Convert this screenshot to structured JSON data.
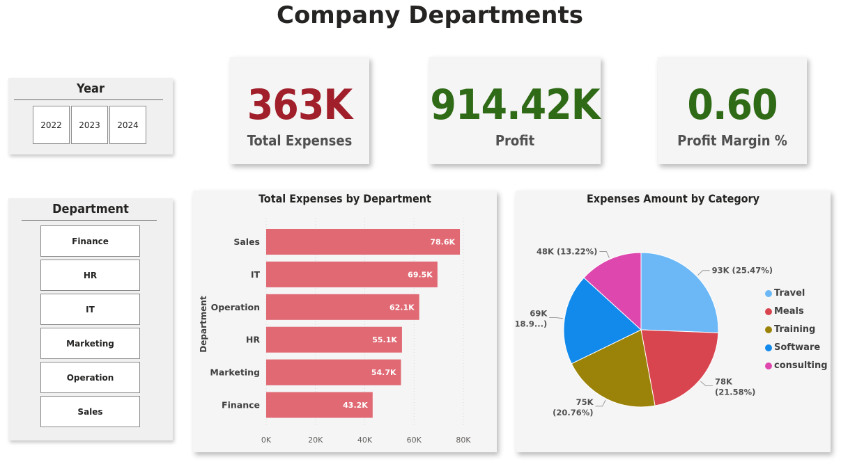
{
  "page": {
    "title": "Company Departments"
  },
  "colors": {
    "expenses": "#a01f2a",
    "profit": "#2f6a16",
    "bar": "#e06973",
    "panel": "#f0f0f0"
  },
  "year_slicer": {
    "title": "Year",
    "items": [
      "2022",
      "2023",
      "2024"
    ]
  },
  "department_slicer": {
    "title": "Department",
    "items": [
      "Finance",
      "HR",
      "IT",
      "Marketing",
      "Operation",
      "Sales"
    ]
  },
  "kpis": {
    "expenses": {
      "value": "363K",
      "label": "Total Expenses"
    },
    "profit": {
      "value": "914.42K",
      "label": "Profit"
    },
    "margin": {
      "value": "0.60",
      "label": "Profit Margin %"
    }
  },
  "chart_data": [
    {
      "type": "bar",
      "orientation": "horizontal",
      "title": "Total Expenses by Department",
      "ylabel": "Department",
      "xlabel": "",
      "categories": [
        "Sales",
        "IT",
        "Operation",
        "HR",
        "Marketing",
        "Finance"
      ],
      "values": [
        78600,
        69500,
        62100,
        55100,
        54700,
        43200
      ],
      "data_labels": [
        "78.6K",
        "69.5K",
        "62.1K",
        "55.1K",
        "54.7K",
        "43.2K"
      ],
      "xlim": [
        0,
        80000
      ],
      "x_ticks": [
        "0K",
        "20K",
        "40K",
        "60K",
        "80K"
      ],
      "grid": true
    },
    {
      "type": "pie",
      "title": "Expenses Amount by Category",
      "labels": [
        "Travel",
        "Meals",
        "Training",
        "Software",
        "consulting"
      ],
      "values": [
        93,
        78,
        75,
        69,
        48
      ],
      "data_labels": [
        "93K (25.47%)",
        "78K (21.58%)",
        "75K (20.76%)",
        "69K (18.9...)",
        "48K (13.22%)"
      ],
      "colors": [
        "#6cb8f7",
        "#d9454f",
        "#9b8309",
        "#128aec",
        "#de47ad"
      ],
      "legend": "right"
    }
  ]
}
